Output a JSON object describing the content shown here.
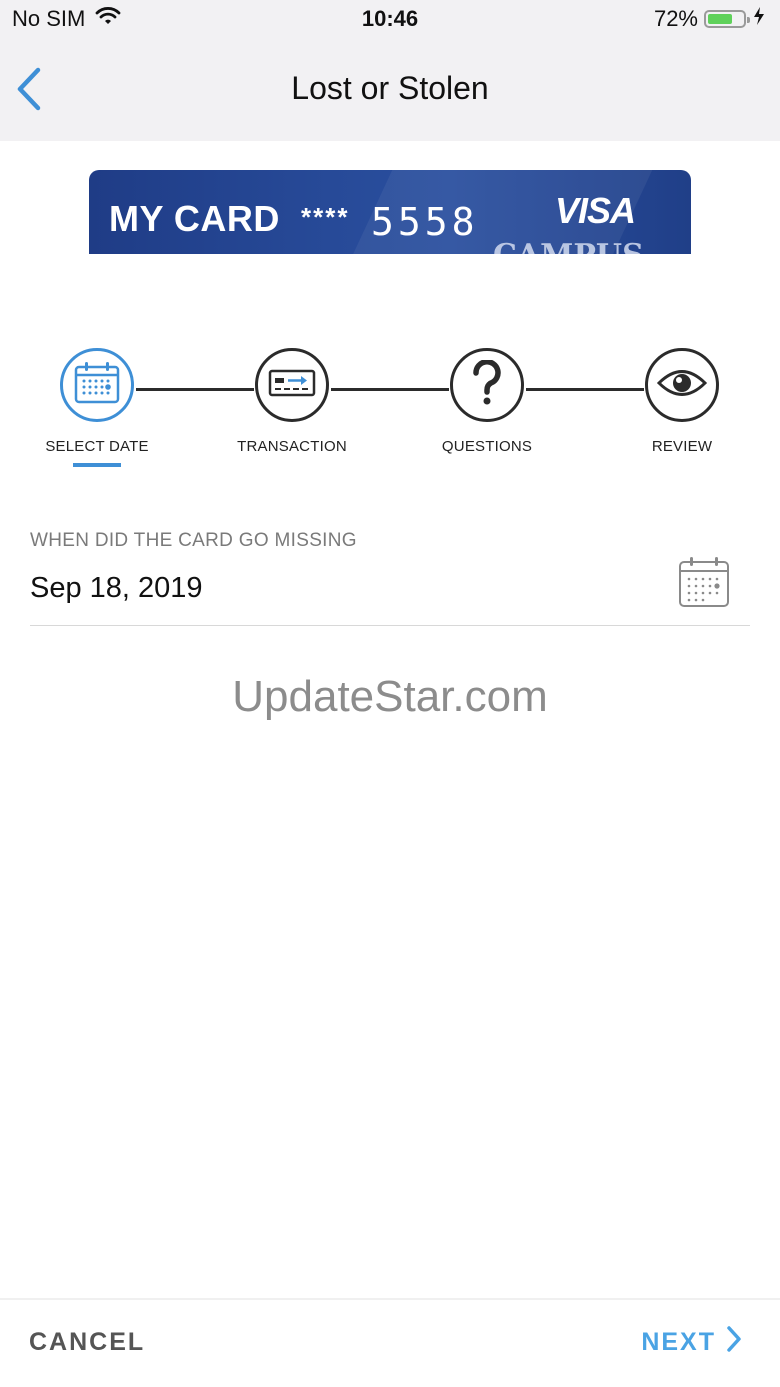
{
  "status_bar": {
    "carrier": "No SIM",
    "time": "10:46",
    "battery_percent": "72%",
    "battery_level": 0.72,
    "battery_color": "#5fd15a"
  },
  "nav": {
    "title": "Lost or Stolen",
    "back_icon": "chevron-left-icon"
  },
  "card": {
    "name": "MY CARD",
    "masked": "****",
    "last_digits": "5558",
    "network": "VISA",
    "bank_partial": "CAMPUS"
  },
  "steps": [
    {
      "label": "SELECT DATE",
      "icon": "calendar-icon",
      "active": true
    },
    {
      "label": "TRANSACTION",
      "icon": "card-transfer-icon",
      "active": false
    },
    {
      "label": "QUESTIONS",
      "icon": "question-icon",
      "active": false
    },
    {
      "label": "REVIEW",
      "icon": "eye-icon",
      "active": false
    }
  ],
  "form": {
    "label": "WHEN DID THE CARD GO MISSING",
    "date_value": "Sep 18, 2019",
    "calendar_icon": "calendar-icon"
  },
  "watermark": "UpdateStar.com",
  "footer": {
    "cancel_label": "CANCEL",
    "next_label": "NEXT"
  },
  "colors": {
    "accent": "#3e8fd6",
    "next": "#4aa3e4",
    "header_bg": "#f2f1f3",
    "card_blue": "#274a98"
  }
}
